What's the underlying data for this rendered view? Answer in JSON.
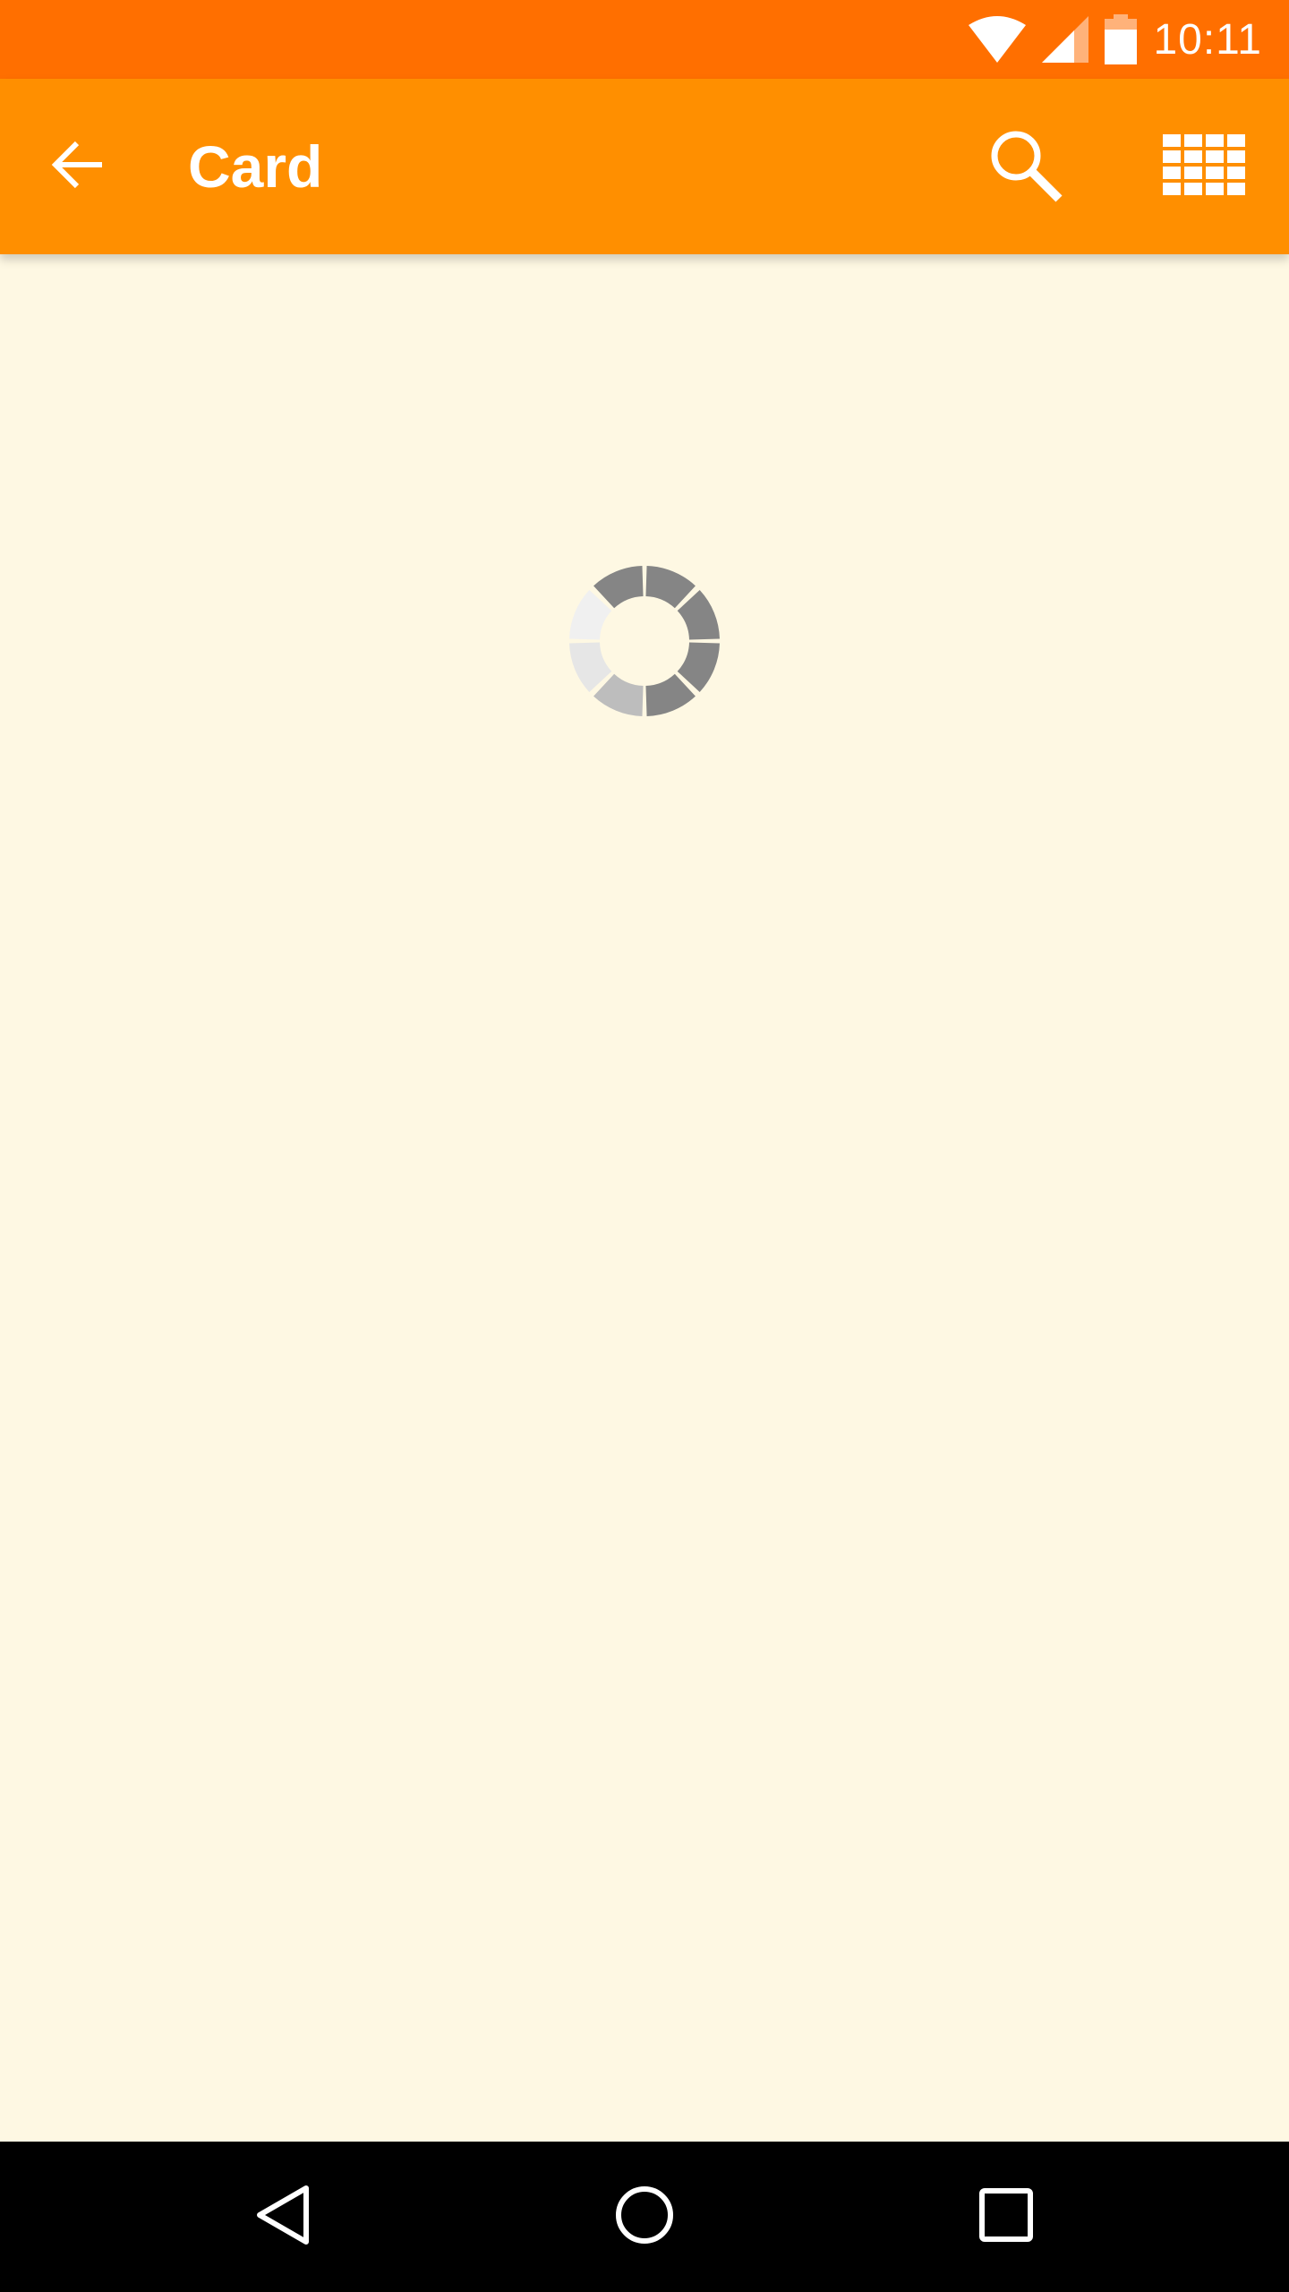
{
  "status_bar": {
    "time": "10:11",
    "icons": [
      "wifi-icon",
      "cell-signal-icon",
      "battery-icon"
    ],
    "background": "#ff6f00"
  },
  "app_bar": {
    "title": "Card",
    "background": "#ff8f00",
    "icons": {
      "back": "arrow-left-icon",
      "search": "search-icon",
      "grid": "grid-icon"
    }
  },
  "content": {
    "background": "#fef8e3",
    "state": "loading",
    "spinner_icon": "loading-spinner-icon"
  },
  "nav_bar": {
    "icons": [
      "nav-back-icon",
      "nav-home-icon",
      "nav-recents-icon"
    ]
  }
}
